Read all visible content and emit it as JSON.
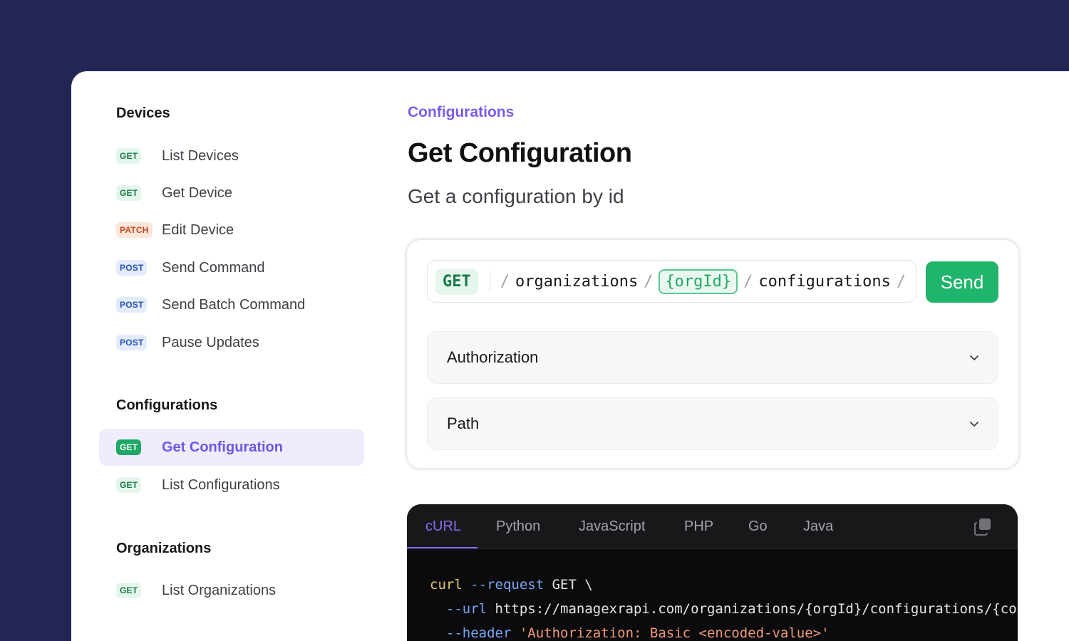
{
  "sidebar": {
    "groups": [
      {
        "title": "Devices",
        "items": [
          {
            "method": "GET",
            "label": "List Devices"
          },
          {
            "method": "GET",
            "label": "Get Device"
          },
          {
            "method": "PATCH",
            "label": "Edit Device"
          },
          {
            "method": "POST",
            "label": "Send Command"
          },
          {
            "method": "POST",
            "label": "Send Batch Command"
          },
          {
            "method": "POST",
            "label": "Pause Updates"
          }
        ]
      },
      {
        "title": "Configurations",
        "items": [
          {
            "method": "GET",
            "label": "Get Configuration",
            "active": true
          },
          {
            "method": "GET",
            "label": "List Configurations"
          }
        ]
      },
      {
        "title": "Organizations",
        "items": [
          {
            "method": "GET",
            "label": "List Organizations"
          }
        ]
      }
    ]
  },
  "header": {
    "eyebrow": "Configurations",
    "title": "Get Configuration",
    "subtitle": "Get a configuration by id"
  },
  "request": {
    "method": "GET",
    "path_segments": [
      "organizations",
      "{orgId}",
      "configurations"
    ],
    "separator": "/",
    "send_label": "Send",
    "sections": [
      "Authorization",
      "Path"
    ]
  },
  "code_example": {
    "tabs": [
      "cURL",
      "Python",
      "JavaScript",
      "PHP",
      "Go",
      "Java"
    ],
    "active_tab": "cURL",
    "lines": {
      "l1_cmd": "curl",
      "l1_flag": "--request",
      "l1_rest": " GET \\",
      "l2_flag": "--url",
      "l2_rest": " https://managexrapi.com/organizations/{orgId}/configurations/{configurationId}",
      "l3_flag": "--header",
      "l3_str": "'Authorization: Basic <encoded-value>'"
    }
  },
  "colors": {
    "background": "#232654",
    "accent": "#7c5ceb",
    "send": "#20b56d",
    "get_badge": "#177a47",
    "post_badge": "#2553b8",
    "patch_badge": "#c4481a"
  }
}
